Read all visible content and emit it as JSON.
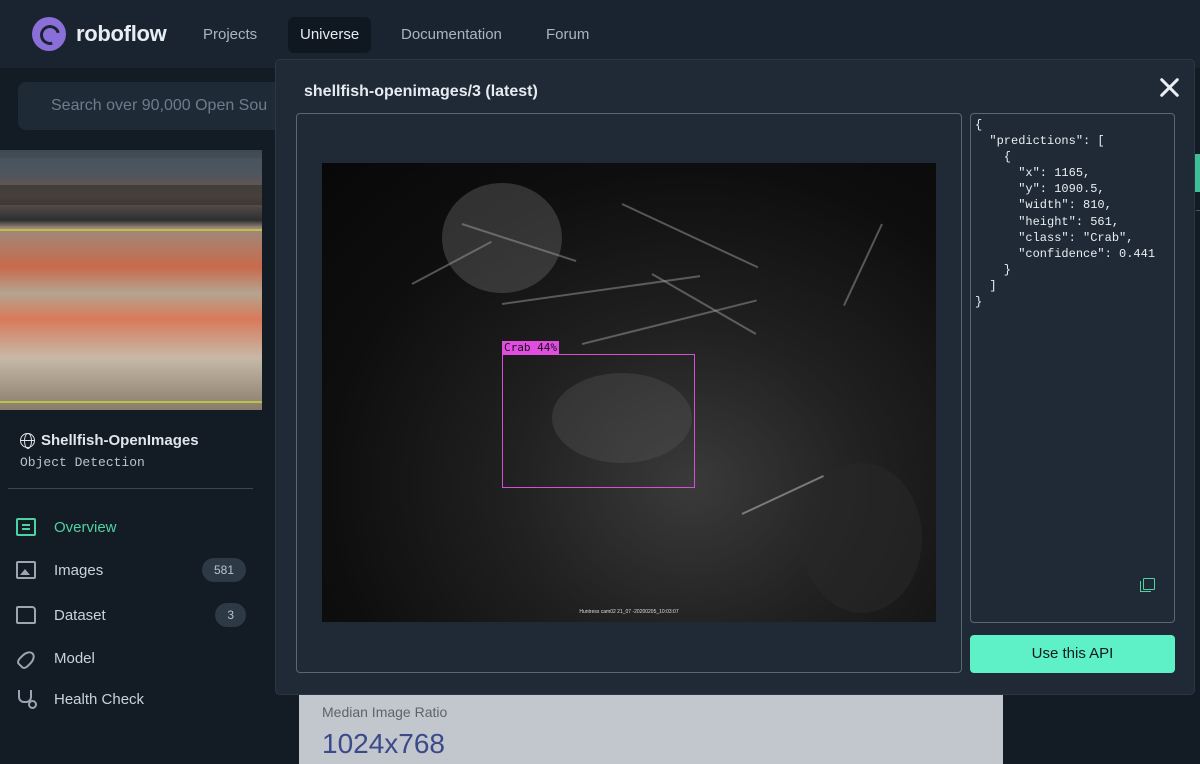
{
  "nav": {
    "brand": "roboflow",
    "items": [
      {
        "label": "Projects"
      },
      {
        "label": "Universe"
      },
      {
        "label": "Documentation"
      },
      {
        "label": "Forum"
      }
    ]
  },
  "search": {
    "placeholder": "Search over 90,000 Open Sou"
  },
  "dataset": {
    "name": "Shellfish-OpenImages",
    "type": "Object Detection"
  },
  "sidebar": {
    "items": [
      {
        "label": "Overview",
        "icon": "book-icon",
        "active": true
      },
      {
        "label": "Images",
        "icon": "images-icon",
        "count": "581"
      },
      {
        "label": "Dataset",
        "icon": "folder-icon",
        "count": "3"
      },
      {
        "label": "Model",
        "icon": "rocket-icon"
      },
      {
        "label": "Health Check",
        "icon": "stethoscope-icon"
      }
    ]
  },
  "stats": {
    "label": "Median Image Ratio",
    "value": "1024x768"
  },
  "modal": {
    "title": "shellfish-openimages/3 (latest)",
    "detection_label": "Crab 44%",
    "photo_caption": "Huntress cam02 21_07 -20200205_10:03:07",
    "json_text": "{\n  \"predictions\": [\n    {\n      \"x\": 1165,\n      \"y\": 1090.5,\n      \"width\": 810,\n      \"height\": 561,\n      \"class\": \"Crab\",\n      \"confidence\": 0.441\n    }\n  ]\n}",
    "api_button": "Use this API"
  },
  "colors": {
    "accent": "#4fd1a5",
    "button": "#5ef0c6",
    "bbox": "#d94ed9",
    "background": "#131b24"
  }
}
